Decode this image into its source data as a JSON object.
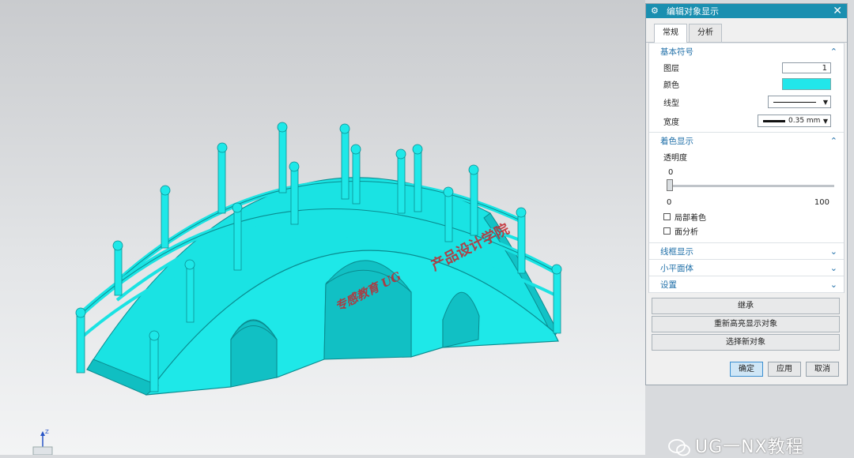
{
  "dialog": {
    "title": "编辑对象显示",
    "tabs": [
      {
        "label": "常规",
        "active": true
      },
      {
        "label": "分析",
        "active": false
      }
    ],
    "sections": {
      "basic": {
        "title": "基本符号",
        "layer_label": "图层",
        "layer_value": "1",
        "color_label": "颜色",
        "color_value": "#22e6ea",
        "linetype_label": "线型",
        "width_label": "宽度",
        "width_value": "0.35 mm"
      },
      "shading": {
        "title": "着色显示",
        "transparency_label": "透明度",
        "transparency_value": "0",
        "slider_min": "0",
        "slider_max": "100",
        "partial_shading_label": "局部着色",
        "face_analysis_label": "面分析"
      },
      "wireframe": {
        "title": "线框显示"
      },
      "facet": {
        "title": "小平面体"
      },
      "settings": {
        "title": "设置"
      }
    },
    "buttons": {
      "inherit": "继承",
      "rehighlight": "重新高亮显示对象",
      "select_new": "选择新对象",
      "ok": "确定",
      "apply": "应用",
      "cancel": "取消"
    }
  },
  "viewport": {
    "model_color": "#1fe6e6",
    "watermark_1": "专感教育 UG",
    "watermark_2": "产品设计学院",
    "triad_label": "Z"
  },
  "wechat": {
    "text": "UG一NX教程"
  }
}
